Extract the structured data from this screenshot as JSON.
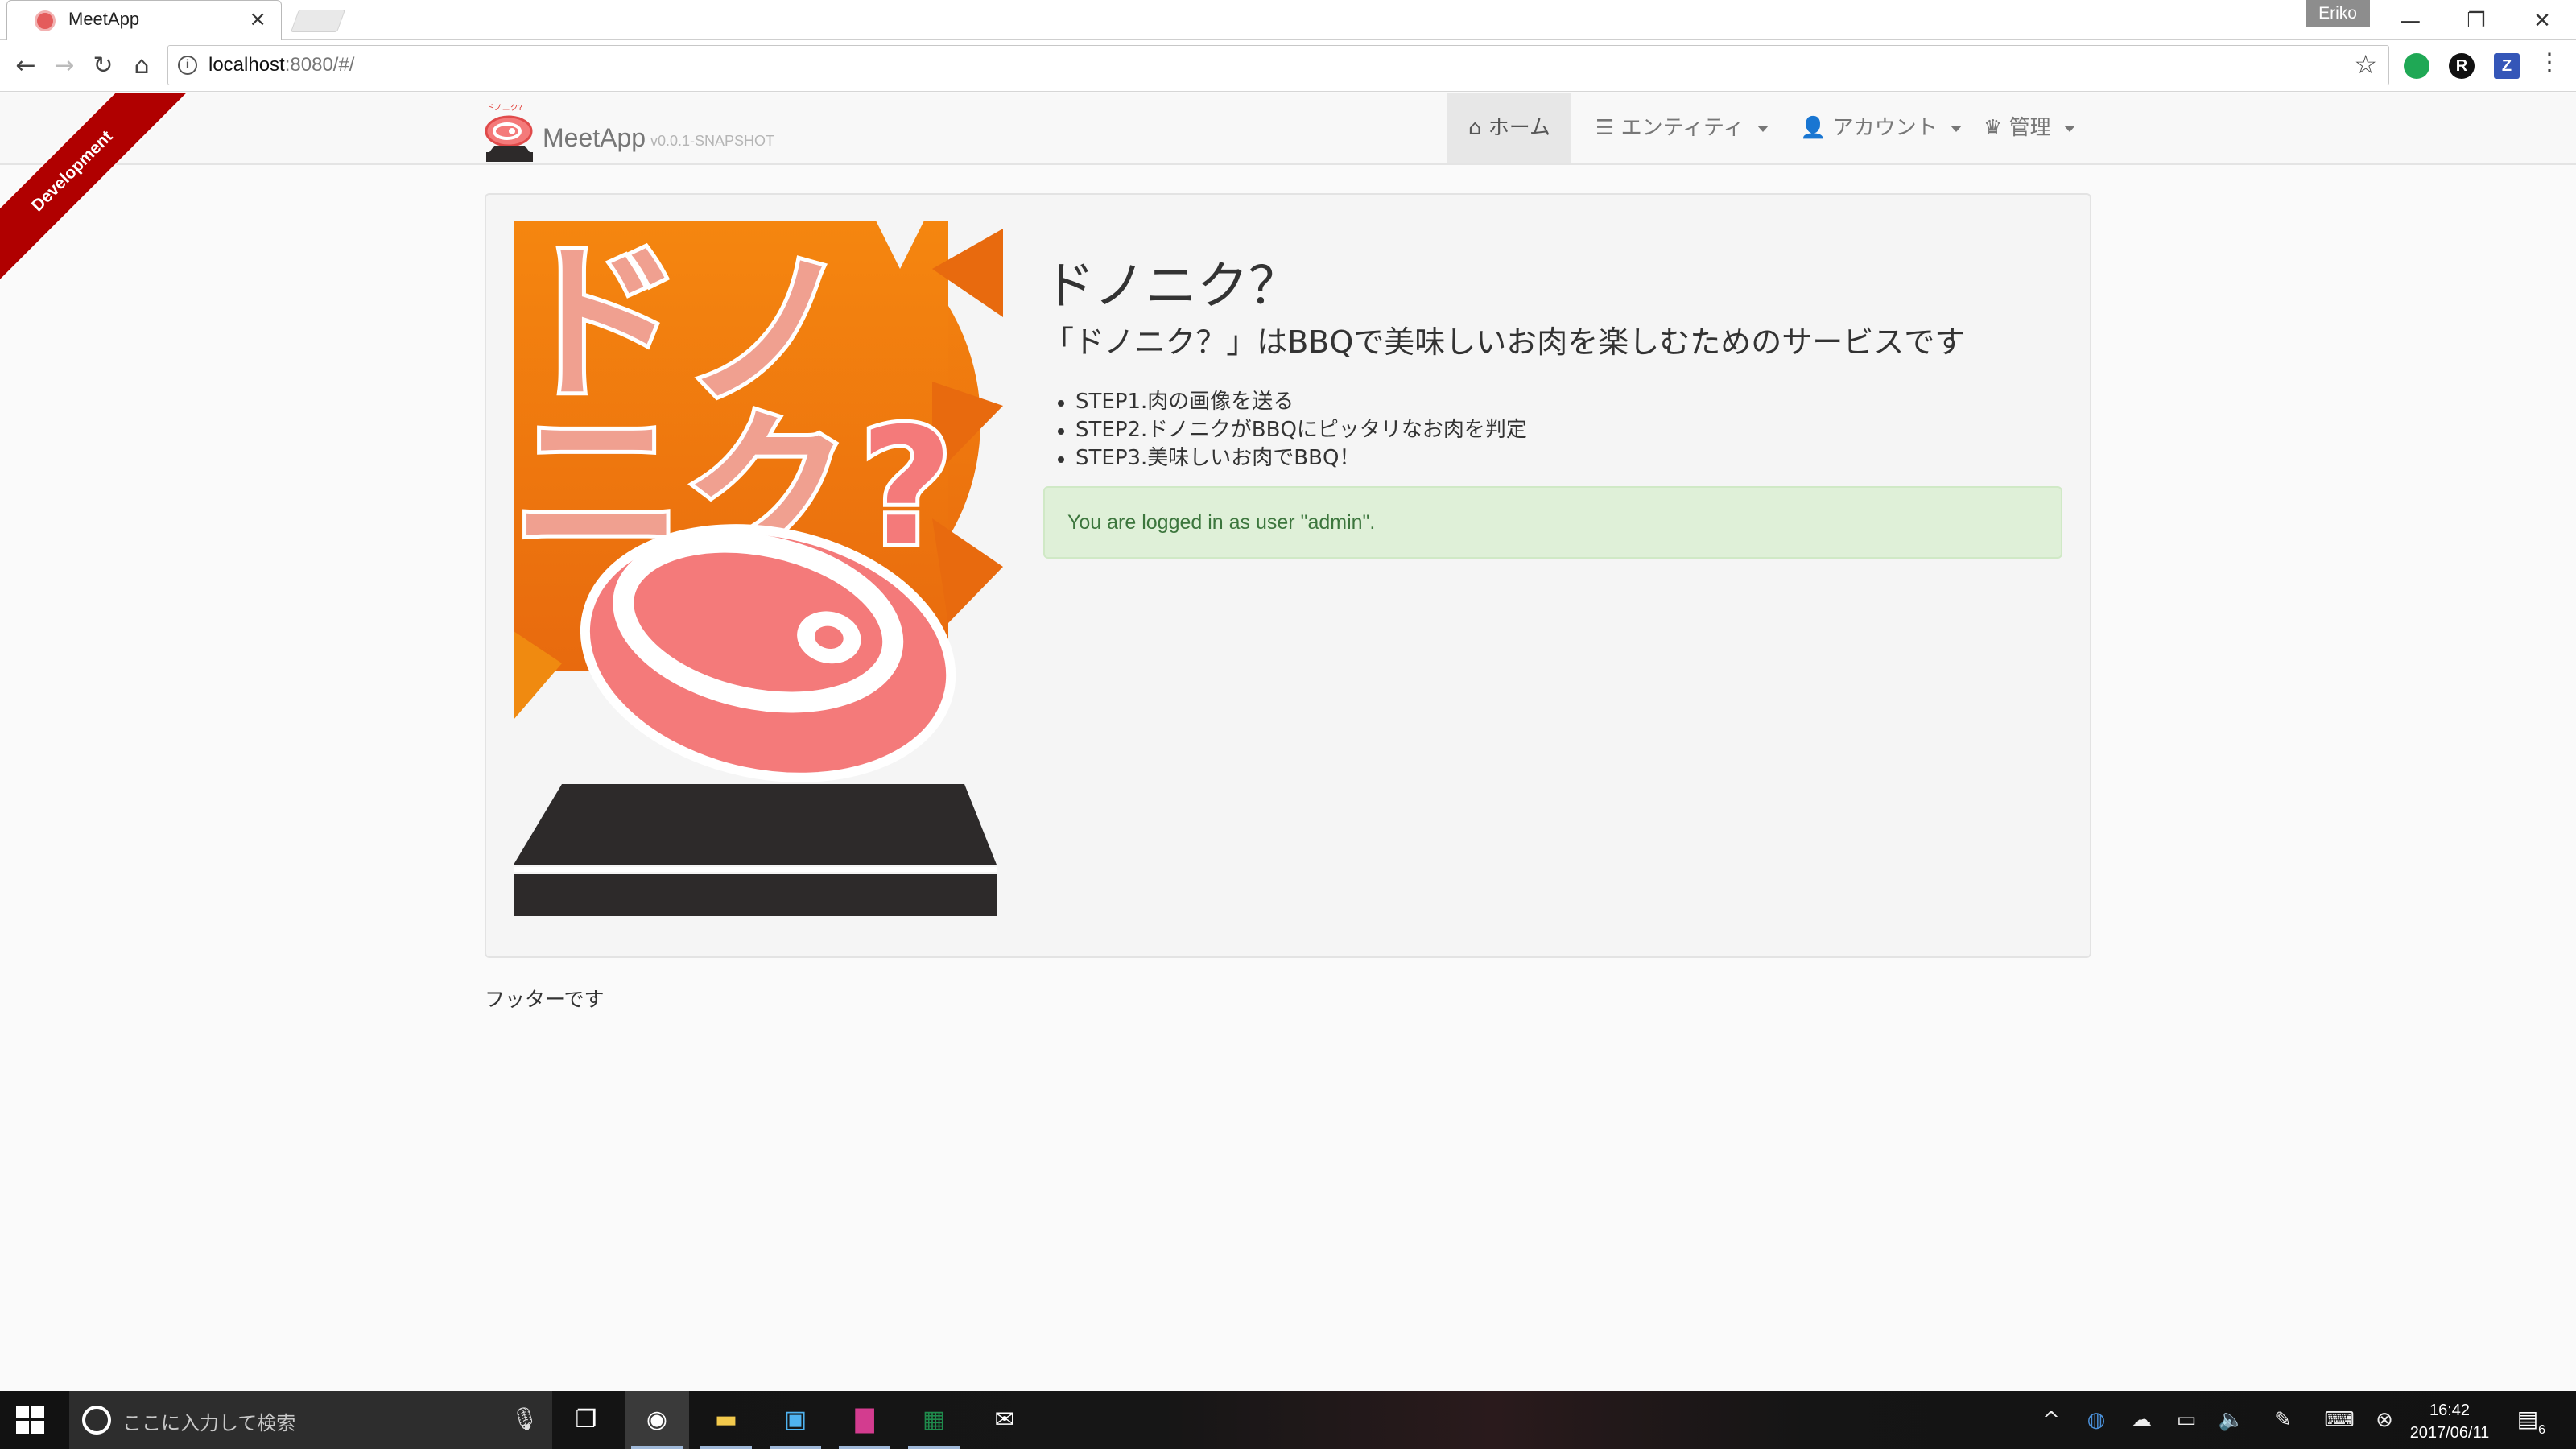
{
  "browser": {
    "tab_title": "MeetApp",
    "tab_close": "×",
    "profile_name": "Eriko",
    "window_controls": {
      "minimize": "—",
      "restore": "❐",
      "close": "✕"
    },
    "nav": {
      "back": "←",
      "forward": "→",
      "reload": "↻",
      "home": "⌂"
    },
    "url_host": "localhost",
    "url_rest": ":8080/#/",
    "extensions": [
      "green-circle-extension",
      "R",
      "Z"
    ],
    "menu": "⋮"
  },
  "ribbon": {
    "label": "Development"
  },
  "navbar": {
    "brand_name": "MeetApp",
    "brand_version": "v0.0.1-SNAPSHOT",
    "items": [
      {
        "label": "ホーム",
        "icon": "home-icon",
        "active": true
      },
      {
        "label": "エンティティ",
        "icon": "list-icon",
        "dropdown": true
      },
      {
        "label": "アカウント",
        "icon": "user-icon",
        "dropdown": true
      },
      {
        "label": "管理",
        "icon": "admin-icon",
        "dropdown": true
      }
    ]
  },
  "hero": {
    "title": "ドノニク？",
    "lead": "「ドノニク？」はBBQで美味しいお肉を楽しむためのサービスです",
    "steps": [
      "STEP1.肉の画像を送る",
      "STEP2.ドノニクがBBQにピッタリなお肉を判定",
      "STEP3.美味しいお肉でBBQ！"
    ],
    "alert": "You are logged in as user \"admin\"."
  },
  "footer": {
    "text": "フッターです"
  },
  "taskbar": {
    "search_placeholder": "ここに入力して検索",
    "clock_time": "16:42",
    "clock_date": "2017/06/11",
    "notification_count": "6"
  },
  "colors": {
    "ribbon": "#b00000",
    "alert_bg": "#dff0d8",
    "alert_text": "#3c763d",
    "meat_pink": "#f47a7a",
    "sun_orange": "#f07a0c"
  }
}
